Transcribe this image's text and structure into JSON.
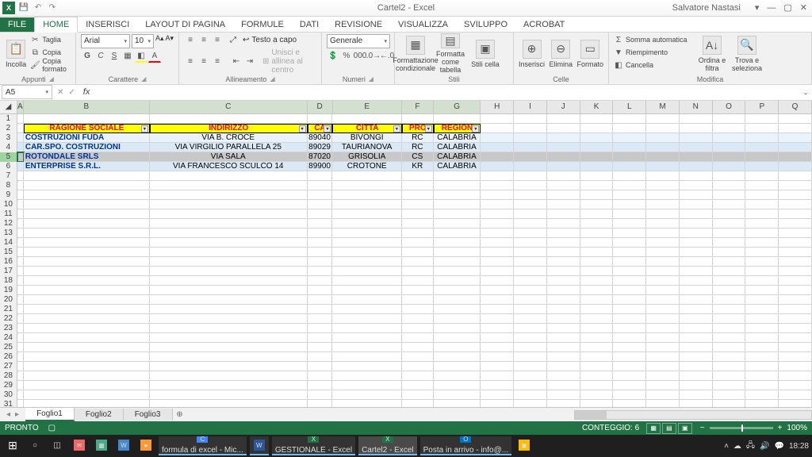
{
  "title": "Cartel2 - Excel",
  "user": "Salvatore Nastasi",
  "tabs": [
    "FILE",
    "HOME",
    "INSERISCI",
    "LAYOUT DI PAGINA",
    "FORMULE",
    "DATI",
    "REVISIONE",
    "VISUALIZZA",
    "SVILUPPO",
    "ACROBAT"
  ],
  "active_tab": "HOME",
  "clipboard": {
    "paste": "Incolla",
    "cut": "Taglia",
    "copy": "Copia",
    "fmt": "Copia formato",
    "label": "Appunti"
  },
  "font": {
    "name": "Arial",
    "size": "10",
    "label": "Carattere"
  },
  "align": {
    "wrap": "Testo a capo",
    "merge": "Unisci e allinea al centro",
    "label": "Allineamento"
  },
  "number": {
    "format": "Generale",
    "label": "Numeri"
  },
  "styles": {
    "cond": "Formattazione condizionale",
    "table": "Formatta come tabella",
    "cell": "Stili cella",
    "label": "Stili"
  },
  "cells": {
    "insert": "Inserisci",
    "delete": "Elimina",
    "format": "Formato",
    "label": "Celle"
  },
  "editing": {
    "sum": "Somma automatica",
    "fill": "Riempimento",
    "clear": "Cancella",
    "sort": "Ordina e filtra",
    "find": "Trova e seleziona",
    "label": "Modifica"
  },
  "namebox": "A5",
  "columns": [
    "A",
    "B",
    "C",
    "D",
    "E",
    "F",
    "G",
    "H",
    "I",
    "J",
    "K",
    "L",
    "M",
    "N",
    "O",
    "P",
    "Q"
  ],
  "headers": {
    "b": "RAGIONE SOCIALE",
    "c": "INDIRIZZO",
    "d": "CA",
    "e": "CITTA",
    "f": "PRO",
    "g": "REGION"
  },
  "data_rows": [
    {
      "b": "COSTRUZIONI FUDA",
      "c": "VIA B. CROCE",
      "d": "89040",
      "e": "BIVONGI",
      "f": "RC",
      "g": "CALABRIA"
    },
    {
      "b": "CAR.SPO. COSTRUZIONI",
      "c": "VIA VIRGILIO PARALLELA 25",
      "d": "89029",
      "e": "TAURIANOVA",
      "f": "RC",
      "g": "CALABRIA"
    },
    {
      "b": "ROTONDALE SRLS",
      "c": "VIA SALA",
      "d": "87020",
      "e": "GRISOLIA",
      "f": "CS",
      "g": "CALABRIA"
    },
    {
      "b": "ENTERPRISE S.R.L.",
      "c": "VIA FRANCESCO SCULCO 14",
      "d": "89900",
      "e": "CROTONE",
      "f": "KR",
      "g": "CALABRIA"
    }
  ],
  "sheets": [
    "Foglio1",
    "Foglio2",
    "Foglio3"
  ],
  "active_sheet": "Foglio1",
  "status": {
    "ready": "PRONTO",
    "count": "CONTEGGIO: 6",
    "zoom": "100%"
  },
  "taskbar": {
    "apps": [
      {
        "label": "formula di excel - Mic...",
        "cls": "chrome"
      },
      {
        "label": "GESTIONALE - Excel",
        "cls": "excel"
      },
      {
        "label": "Cartel2 - Excel",
        "cls": "excel",
        "active": true
      },
      {
        "label": "Posta in arrivo - info@...",
        "cls": "outlook"
      }
    ],
    "time": "18:28"
  }
}
